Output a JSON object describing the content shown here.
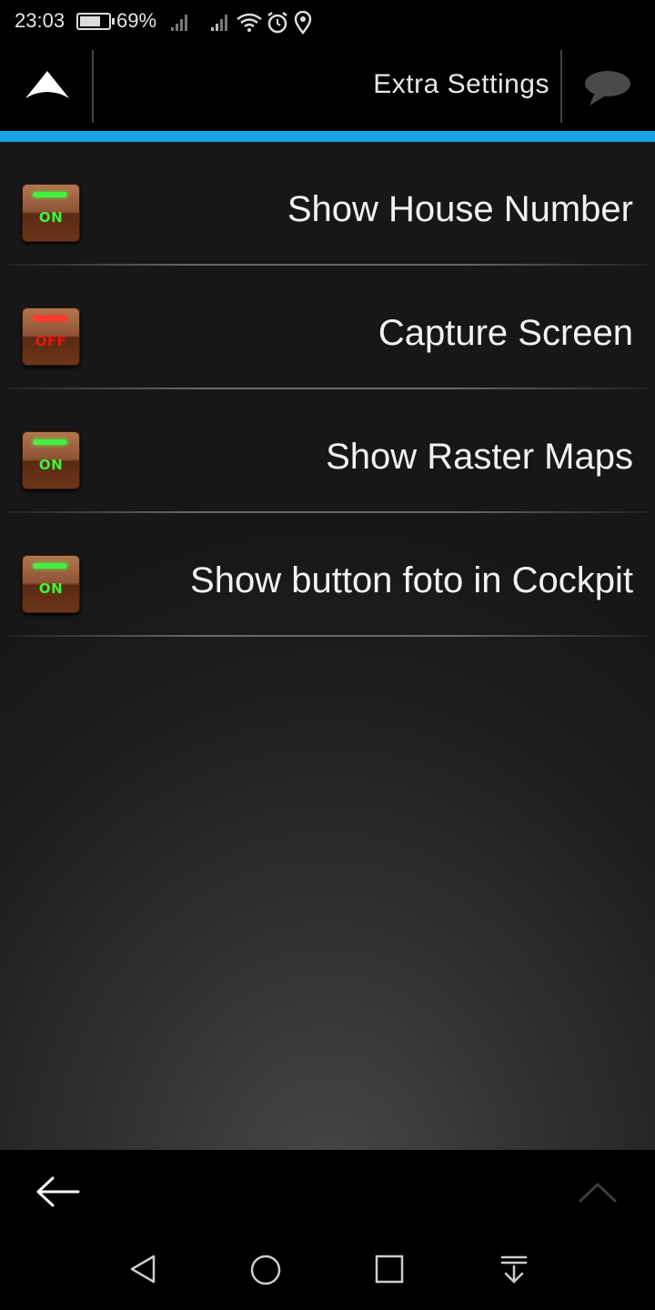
{
  "status_bar": {
    "time": "23:03",
    "battery_percent": "69%",
    "battery_level": 0.69,
    "icons": [
      "signal-icon",
      "signal-icon",
      "wifi-icon",
      "alarm-icon",
      "location-icon"
    ]
  },
  "header": {
    "title": "Extra Settings",
    "left_icon": "up-arrow-icon",
    "right_icon": "chat-bubble-icon",
    "accent_color": "#1aa3e8"
  },
  "settings": [
    {
      "label": "Show House Number",
      "state": "ON"
    },
    {
      "label": "Capture Screen",
      "state": "OFF"
    },
    {
      "label": "Show Raster Maps",
      "state": "ON"
    },
    {
      "label": "Show button foto in Cockpit",
      "state": "ON"
    }
  ],
  "bottom_bar": {
    "left_icon": "back-arrow-icon",
    "right_icon": "chevron-up-icon"
  },
  "nav_bar": {
    "icons": [
      "nav-back-icon",
      "nav-home-icon",
      "nav-recents-icon",
      "nav-notifications-icon"
    ]
  }
}
